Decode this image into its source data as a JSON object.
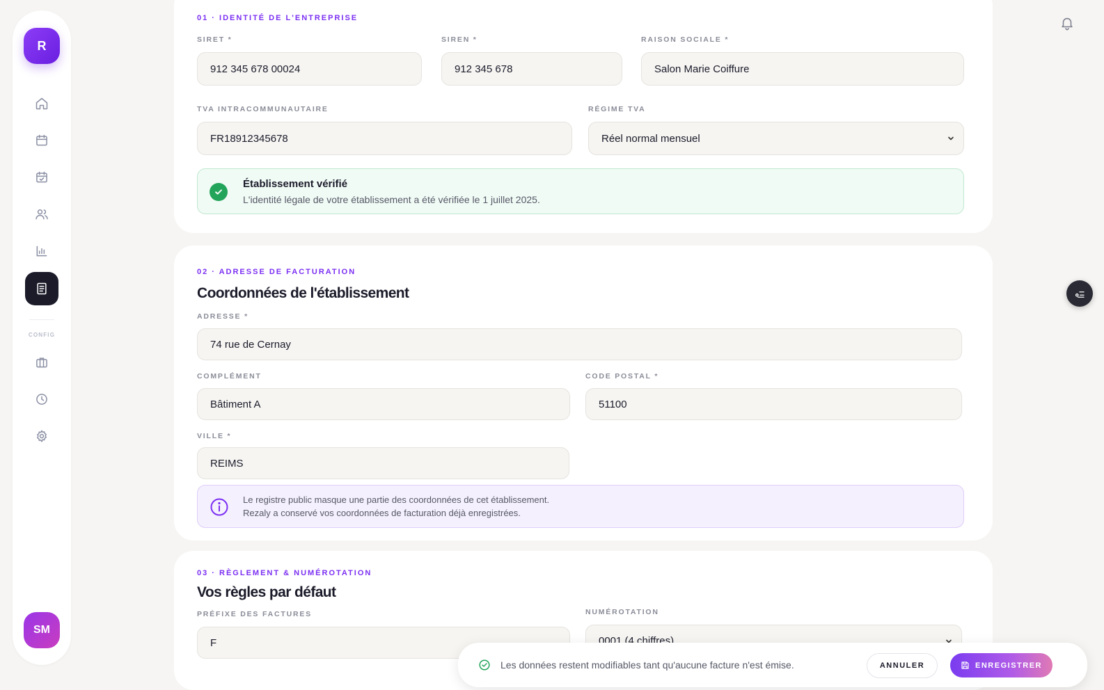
{
  "sidebar": {
    "logo": "R",
    "config_label": "CONFIG",
    "avatar": "SM",
    "items": [
      {
        "icon": "home-icon"
      },
      {
        "icon": "calendar-icon"
      },
      {
        "icon": "calendar-check-icon"
      },
      {
        "icon": "users-icon"
      },
      {
        "icon": "chart-icon"
      },
      {
        "icon": "invoice-icon",
        "active": true
      },
      {
        "icon": "briefcase-icon"
      },
      {
        "icon": "clock-icon"
      },
      {
        "icon": "gear-icon"
      }
    ]
  },
  "section1": {
    "label": "01 · IDENTITÉ DE L'ENTREPRISE",
    "siret": {
      "label": "SIRET *",
      "value": "912 345 678 00024"
    },
    "siren": {
      "label": "SIREN *",
      "value": "912 345 678"
    },
    "raison": {
      "label": "RAISON SOCIALE *",
      "value": "Salon Marie Coiffure"
    },
    "tva": {
      "label": "TVA INTRACOMMUNAUTAIRE",
      "value": "FR18912345678"
    },
    "regime": {
      "label": "RÉGIME TVA",
      "value": "Réel normal mensuel"
    },
    "verified": {
      "title": "Établissement vérifié",
      "desc": "L'identité légale de votre établissement a été vérifiée le 1 juillet 2025."
    }
  },
  "section2": {
    "label": "02 · ADRESSE DE FACTURATION",
    "title": "Coordonnées de l'établissement",
    "adresse": {
      "label": "ADRESSE *",
      "value": "74 rue de Cernay"
    },
    "complement": {
      "label": "COMPLÉMENT",
      "value": "Bâtiment A"
    },
    "code_postal": {
      "label": "CODE POSTAL *",
      "value": "51100"
    },
    "ville": {
      "label": "VILLE *",
      "value": "REIMS"
    },
    "info": {
      "line1": "Le registre public masque une partie des coordonnées de cet établissement.",
      "line2": "Rezaly a conservé vos coordonnées de facturation déjà enregistrées."
    }
  },
  "section3": {
    "label": "03 · RÈGLEMENT & NUMÉROTATION",
    "title": "Vos règles par défaut",
    "prefixe": {
      "label": "PRÉFIXE DES FACTURES",
      "value": "F"
    },
    "numerotation": {
      "label": "NUMÉROTATION",
      "value": "0001 (4 chiffres)"
    }
  },
  "bottom_bar": {
    "message": "Les données restent modifiables tant qu'aucune facture n'est émise.",
    "cancel": "ANNULER",
    "save": "ENREGISTRER"
  },
  "colors": {
    "accent": "#7b2ff2",
    "success": "#22a45a",
    "dark": "#1b1b2a"
  }
}
